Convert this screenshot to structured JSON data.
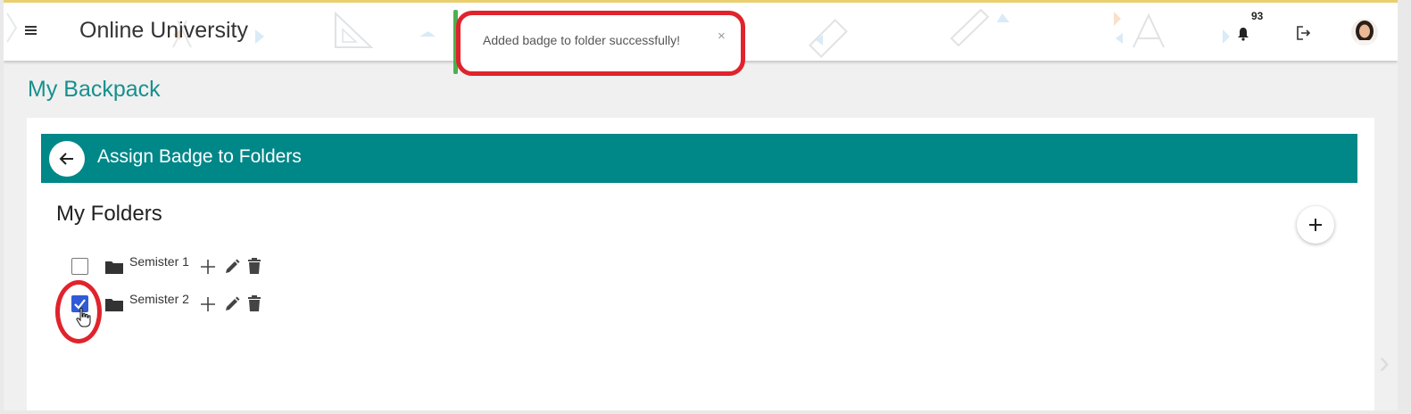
{
  "header": {
    "app_title": "Online University",
    "notification_count": "93",
    "icons": {
      "menu": "hamburger-menu-icon",
      "notifications": "bell-icon",
      "logout": "logout-icon",
      "avatar": "user-avatar"
    }
  },
  "toast": {
    "message": "Added badge to folder successfully!",
    "close_label": "×",
    "accent_color": "#4caf50"
  },
  "page": {
    "title": "My Backpack"
  },
  "card": {
    "header_title": "Assign Badge to Folders",
    "header_color": "#008788",
    "folders_title": "My Folders",
    "folders": [
      {
        "label": "Semister 1",
        "checked": false
      },
      {
        "label": "Semister 2",
        "checked": true
      }
    ]
  },
  "colors": {
    "accent_teal": "#17908e",
    "highlight_red": "#e0232c",
    "checkbox_blue": "#2f5bd8"
  }
}
